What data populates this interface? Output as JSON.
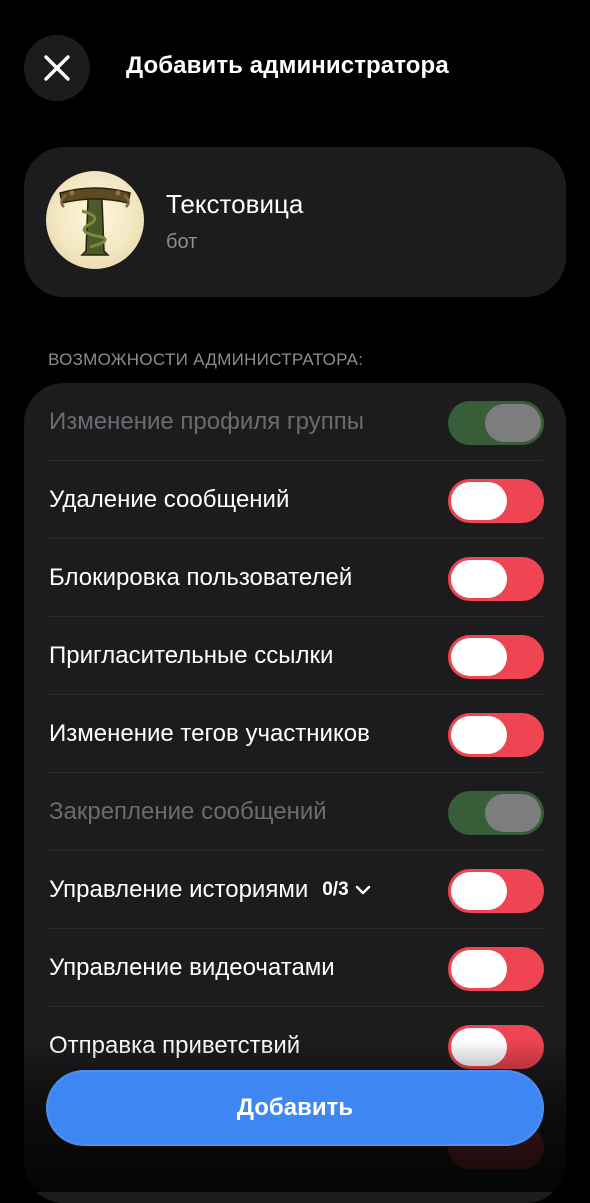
{
  "header": {
    "title": "Добавить администратора",
    "close_icon": "close-icon"
  },
  "profile": {
    "name": "Текстовица",
    "subtitle": "бот",
    "avatar_icon": "ornate-letter-t-avatar",
    "avatar_letter": "T"
  },
  "section": {
    "title": "ВОЗМОЖНОСТИ АДМИНИСТРАТОРА:"
  },
  "permissions": [
    {
      "label": "Изменение профиля группы",
      "state": "on",
      "disabled": true
    },
    {
      "label": "Удаление сообщений",
      "state": "off",
      "disabled": false
    },
    {
      "label": "Блокировка пользователей",
      "state": "off",
      "disabled": false
    },
    {
      "label": "Пригласительные ссылки",
      "state": "off",
      "disabled": false
    },
    {
      "label": "Изменение тегов участников",
      "state": "off",
      "disabled": false
    },
    {
      "label": "Закрепление сообщений",
      "state": "on",
      "disabled": true
    },
    {
      "label": "Управление историями",
      "counter": "0/3",
      "state": "off",
      "disabled": false
    },
    {
      "label": "Управление видеочатами",
      "state": "off",
      "disabled": false
    },
    {
      "label": "Отправка приветствий",
      "state": "off",
      "disabled": false
    }
  ],
  "footer": {
    "add_label": "Добавить"
  },
  "colors": {
    "background": "#000000",
    "card": "#1c1c1e",
    "toggle_off": "#ef4452",
    "toggle_disabled_on": "#385d39",
    "accent_button": "#3e87f3",
    "secondary_text": "#8d8d93"
  }
}
